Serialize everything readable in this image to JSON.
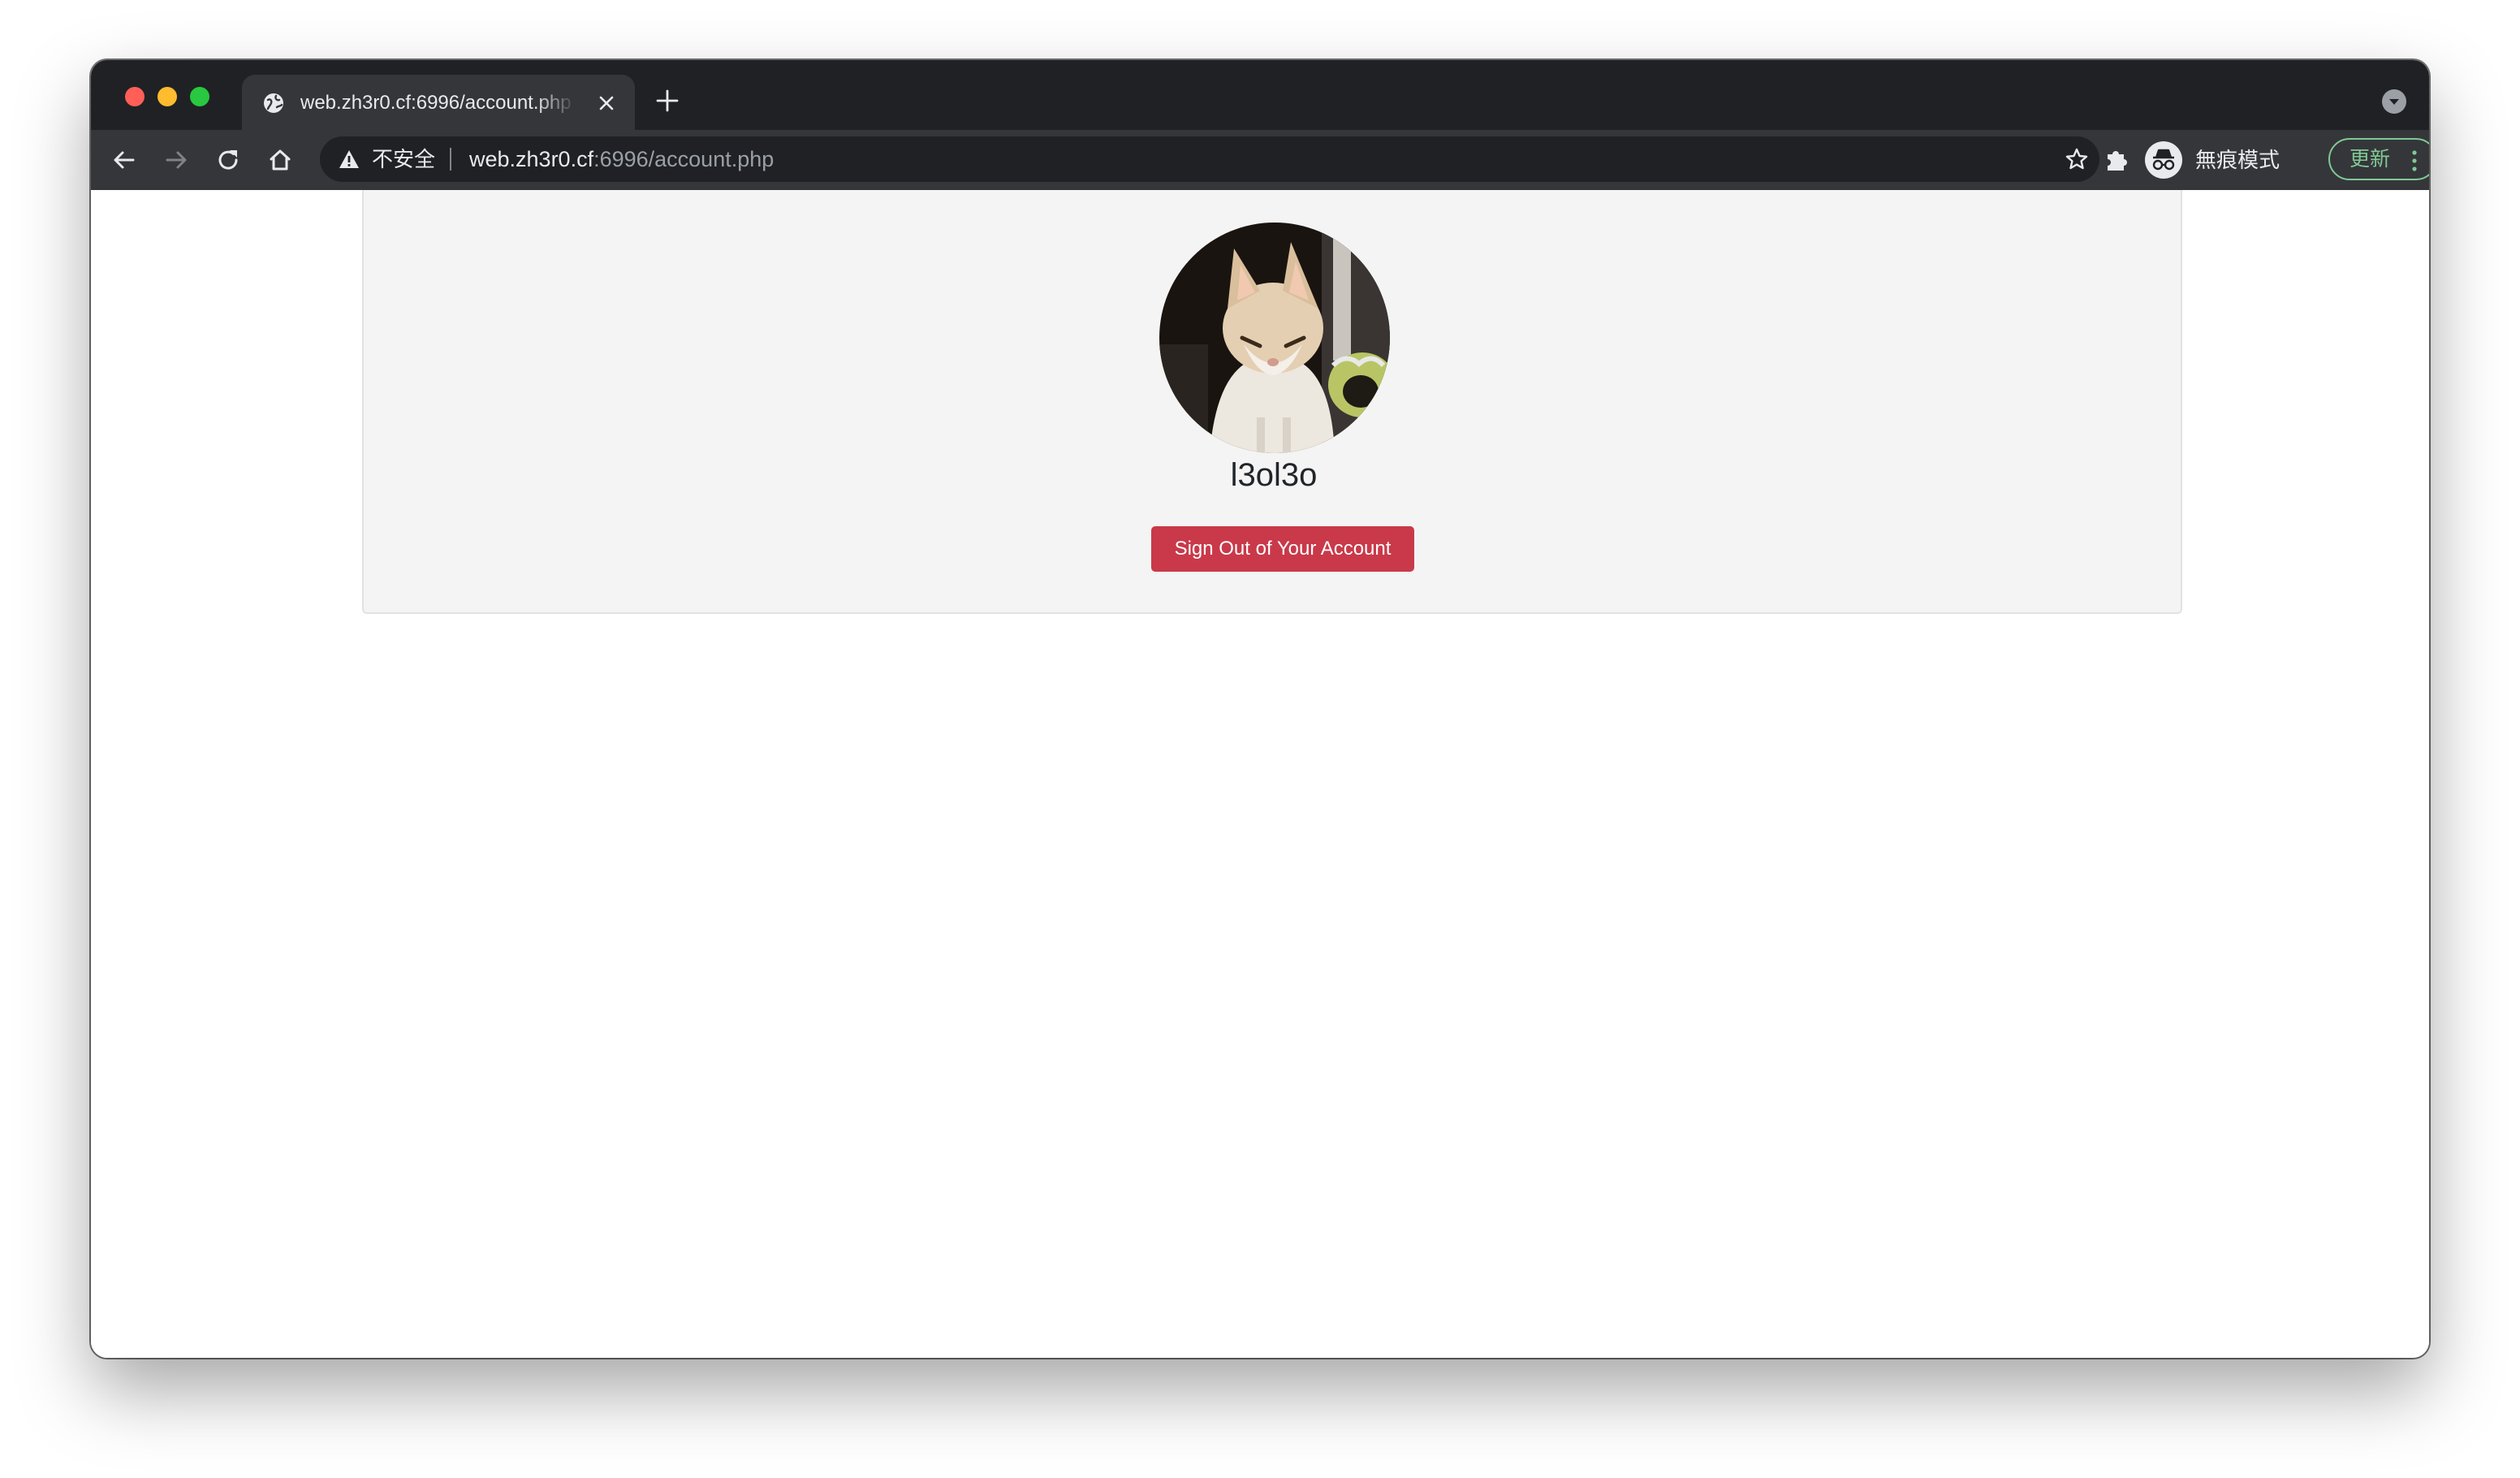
{
  "browser": {
    "tab": {
      "title": "web.zh3r0.cf:6996/account.php",
      "icon": "globe-icon"
    },
    "omnibox": {
      "security_label": "不安全",
      "url_host": "web.zh3r0.cf",
      "url_rest": ":6996/account.php"
    },
    "profile": {
      "label": "無痕模式",
      "icon": "incognito-icon"
    },
    "update_button": {
      "label": "更新"
    },
    "colors": {
      "tabstrip": "#202124",
      "toolbar": "#35363a",
      "update_accent": "#81c995"
    }
  },
  "page": {
    "profile": {
      "avatar": "cat-photo",
      "username": "l3ol3o"
    },
    "signout_button": {
      "label": "Sign Out of Your Account",
      "color": "#c9394a"
    }
  }
}
